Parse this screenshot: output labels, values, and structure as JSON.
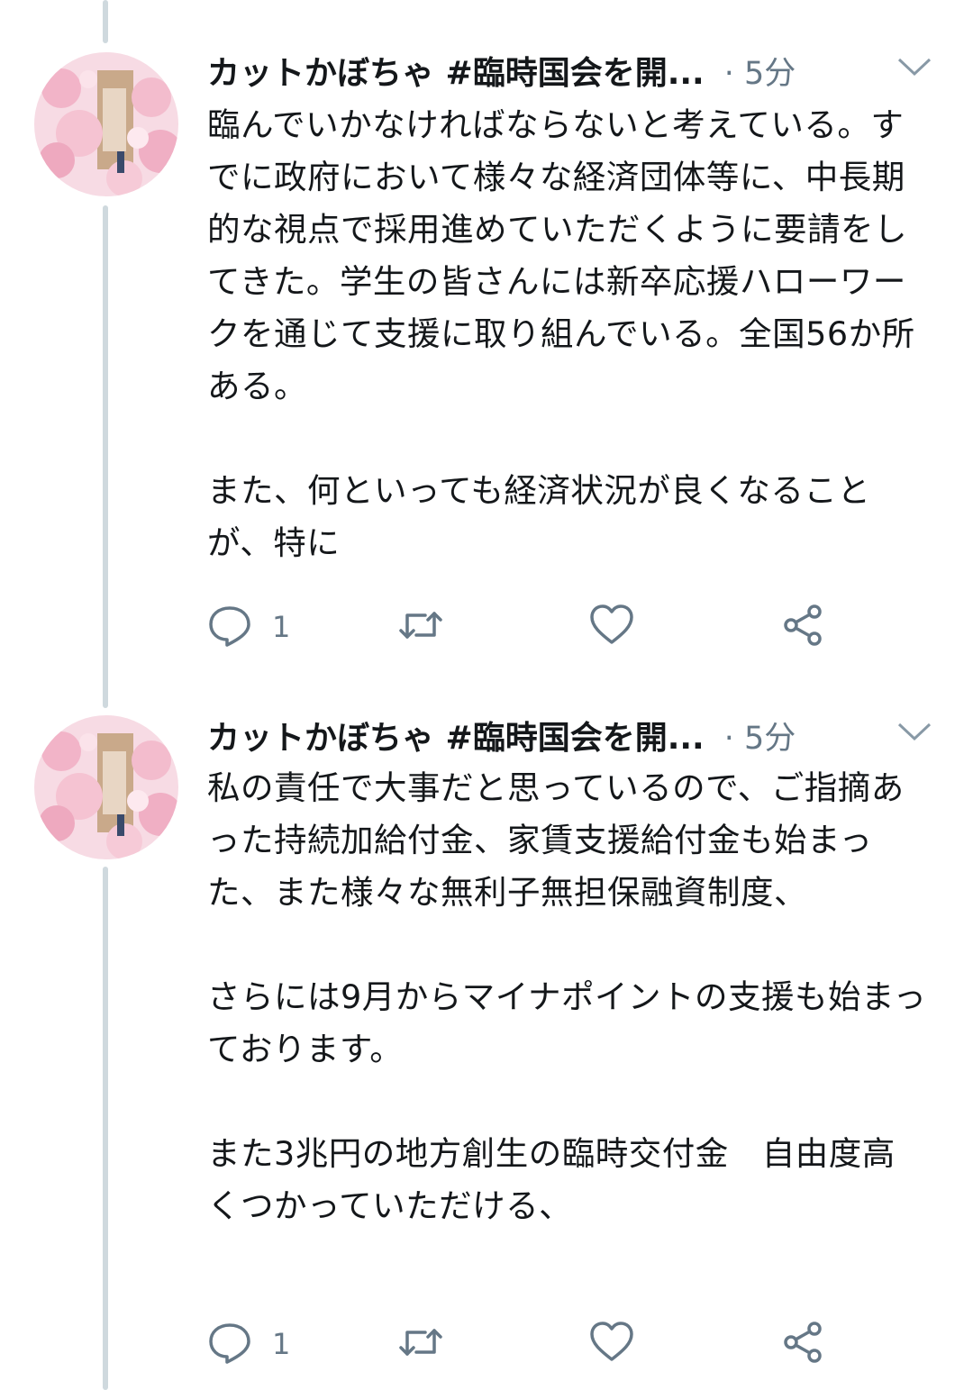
{
  "tweets": [
    {
      "author": "カットかぼちゃ #臨時国会を開...",
      "time": "· 5分",
      "text": "臨んでいかなければならないと考えている。すでに政府において様々な経済団体等に、中長期的な視点で採用進めていただくように要請をしてきた。学生の皆さんには新卒応援ハローワークを通じて支援に取り組んでいる。全国56か所ある。\n\nまた、何といっても経済状況が良くなることが、特に",
      "reply_count": "1"
    },
    {
      "author": "カットかぼちゃ #臨時国会を開...",
      "time": "· 5分",
      "text": "私の責任で大事だと思っているので、ご指摘あった持続加給付金、家賃支援給付金も始まった、また様々な無利子無担保融資制度、\n\nさらには9月からマイナポイントの支援も始まっております。\n\nまた3兆円の地方創生の臨時交付金　自由度高くつかっていただける、",
      "reply_count": "1"
    }
  ],
  "icons": {
    "reply": "reply-icon",
    "retweet": "retweet-icon",
    "like": "heart-icon",
    "share": "share-icon",
    "menu": "chevron-down-icon"
  },
  "colors": {
    "text": "#14171a",
    "muted": "#657786",
    "thread_line": "#cfd9de",
    "avatar_pink": "#f4c6d4"
  }
}
